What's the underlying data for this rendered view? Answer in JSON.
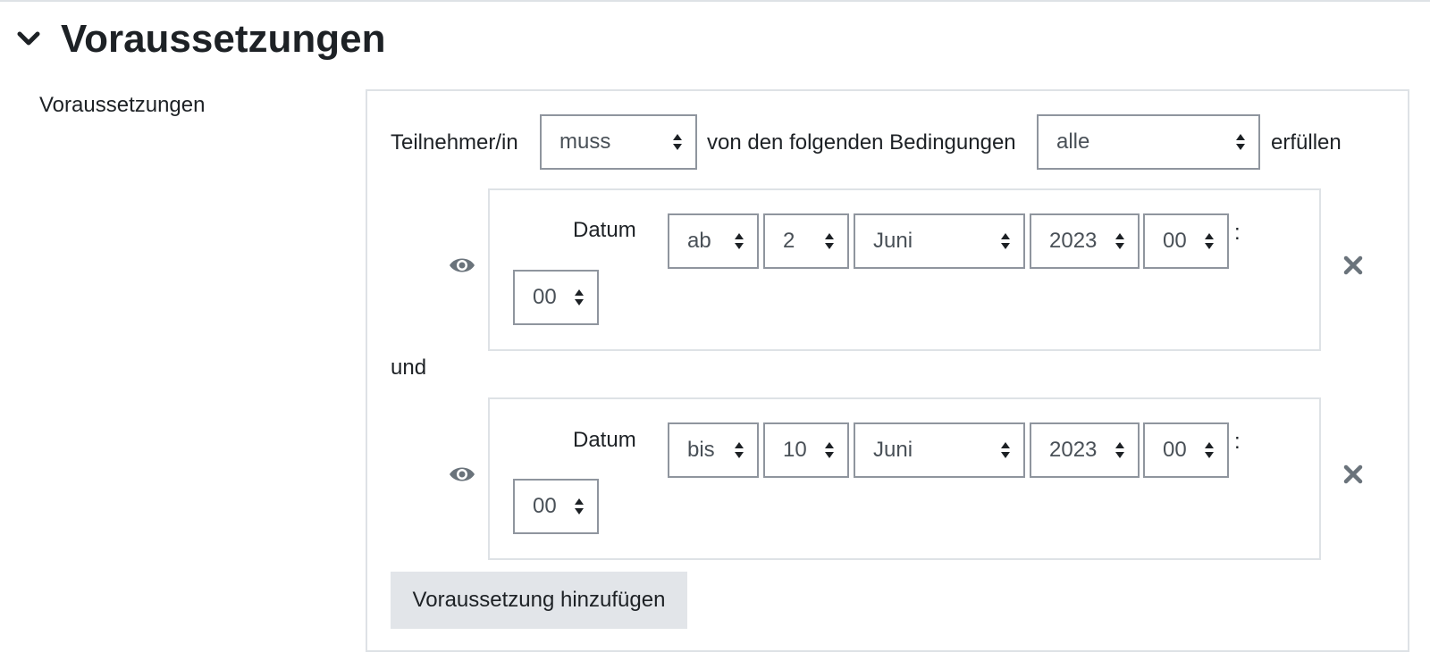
{
  "section": {
    "title": "Voraussetzungen",
    "toggle_icon": "chevron-down-icon"
  },
  "field": {
    "label": "Voraussetzungen"
  },
  "header_row": {
    "prefix": "Teilnehmer/in",
    "must_select": "muss",
    "middle": "von den folgenden Bedingungen",
    "scope_select": "alle",
    "suffix": "erfüllen"
  },
  "conditions": [
    {
      "label": "Datum",
      "direction": "ab",
      "day": "2",
      "month": "Juni",
      "year": "2023",
      "hour": "00",
      "separator": ":",
      "minute": "00",
      "eye_icon": "eye-icon",
      "delete_icon": "close-icon"
    },
    {
      "label": "Datum",
      "direction": "bis",
      "day": "10",
      "month": "Juni",
      "year": "2023",
      "hour": "00",
      "separator": ":",
      "minute": "00",
      "eye_icon": "eye-icon",
      "delete_icon": "close-icon"
    }
  ],
  "connector": "und",
  "add_button": "Voraussetzung hinzufügen",
  "colors": {
    "text": "#1d2125",
    "select_text": "#495057",
    "select_border": "#8f959e",
    "panel_border": "#dee2e6",
    "button_bg": "#e2e5e9",
    "icon_gray": "#6a737b"
  }
}
